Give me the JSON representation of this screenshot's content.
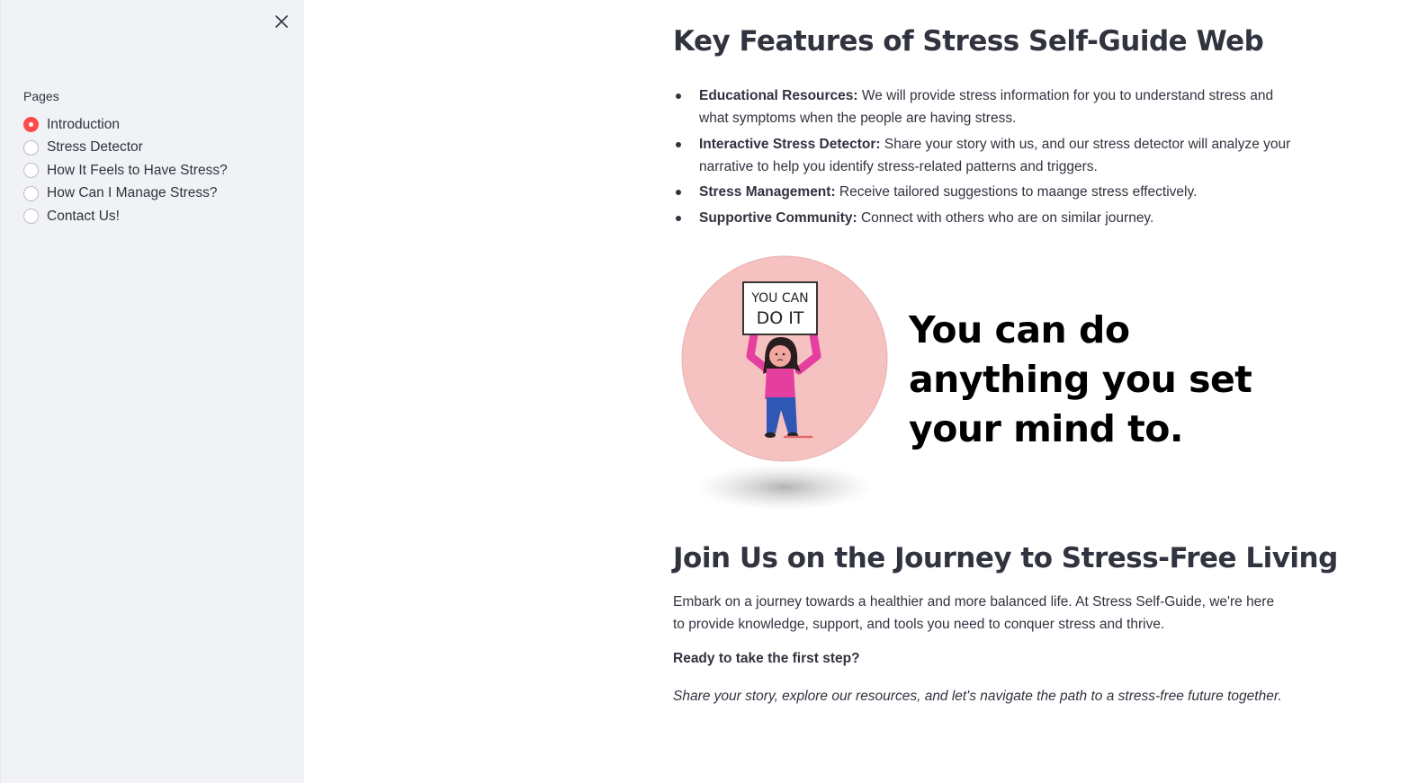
{
  "sidebar": {
    "label": "Pages",
    "selected_color": "#ff4b4b",
    "items": [
      {
        "label": "Introduction",
        "selected": true
      },
      {
        "label": "Stress Detector",
        "selected": false
      },
      {
        "label": "How It Feels to Have Stress?",
        "selected": false
      },
      {
        "label": "How Can I Manage Stress?",
        "selected": false
      },
      {
        "label": "Contact Us!",
        "selected": false
      }
    ]
  },
  "main": {
    "features_title": "Key Features of Stress Self-Guide Web",
    "features": [
      {
        "bold": "Educational Resources:",
        "text": " We will provide stress information for you to understand stress and what symptoms when the people are having stress."
      },
      {
        "bold": "Interactive Stress Detector:",
        "text": " Share your story with us, and our stress detector will analyze your narrative to help you identify stress-related patterns and triggers."
      },
      {
        "bold": "Stress Management:",
        "text": " Receive tailored suggestions to maange stress effectively."
      },
      {
        "bold": "Supportive Community:",
        "text": " Connect with others who are on similar journey."
      }
    ],
    "illustration": {
      "sign_line1": "YOU CAN",
      "sign_line2": "DO IT",
      "quote": "You can do anything you set your mind to."
    },
    "join_title": "Join Us on the Journey to Stress-Free Living",
    "join_body": "Embark on a journey towards a healthier and more balanced life. At Stress Self-Guide, we're here to provide knowledge, support, and tools you need to conquer stress and thrive.",
    "ready": "Ready to take the first step?",
    "share": "Share your story, explore our resources, and let's navigate the path to a stress-free future together."
  }
}
